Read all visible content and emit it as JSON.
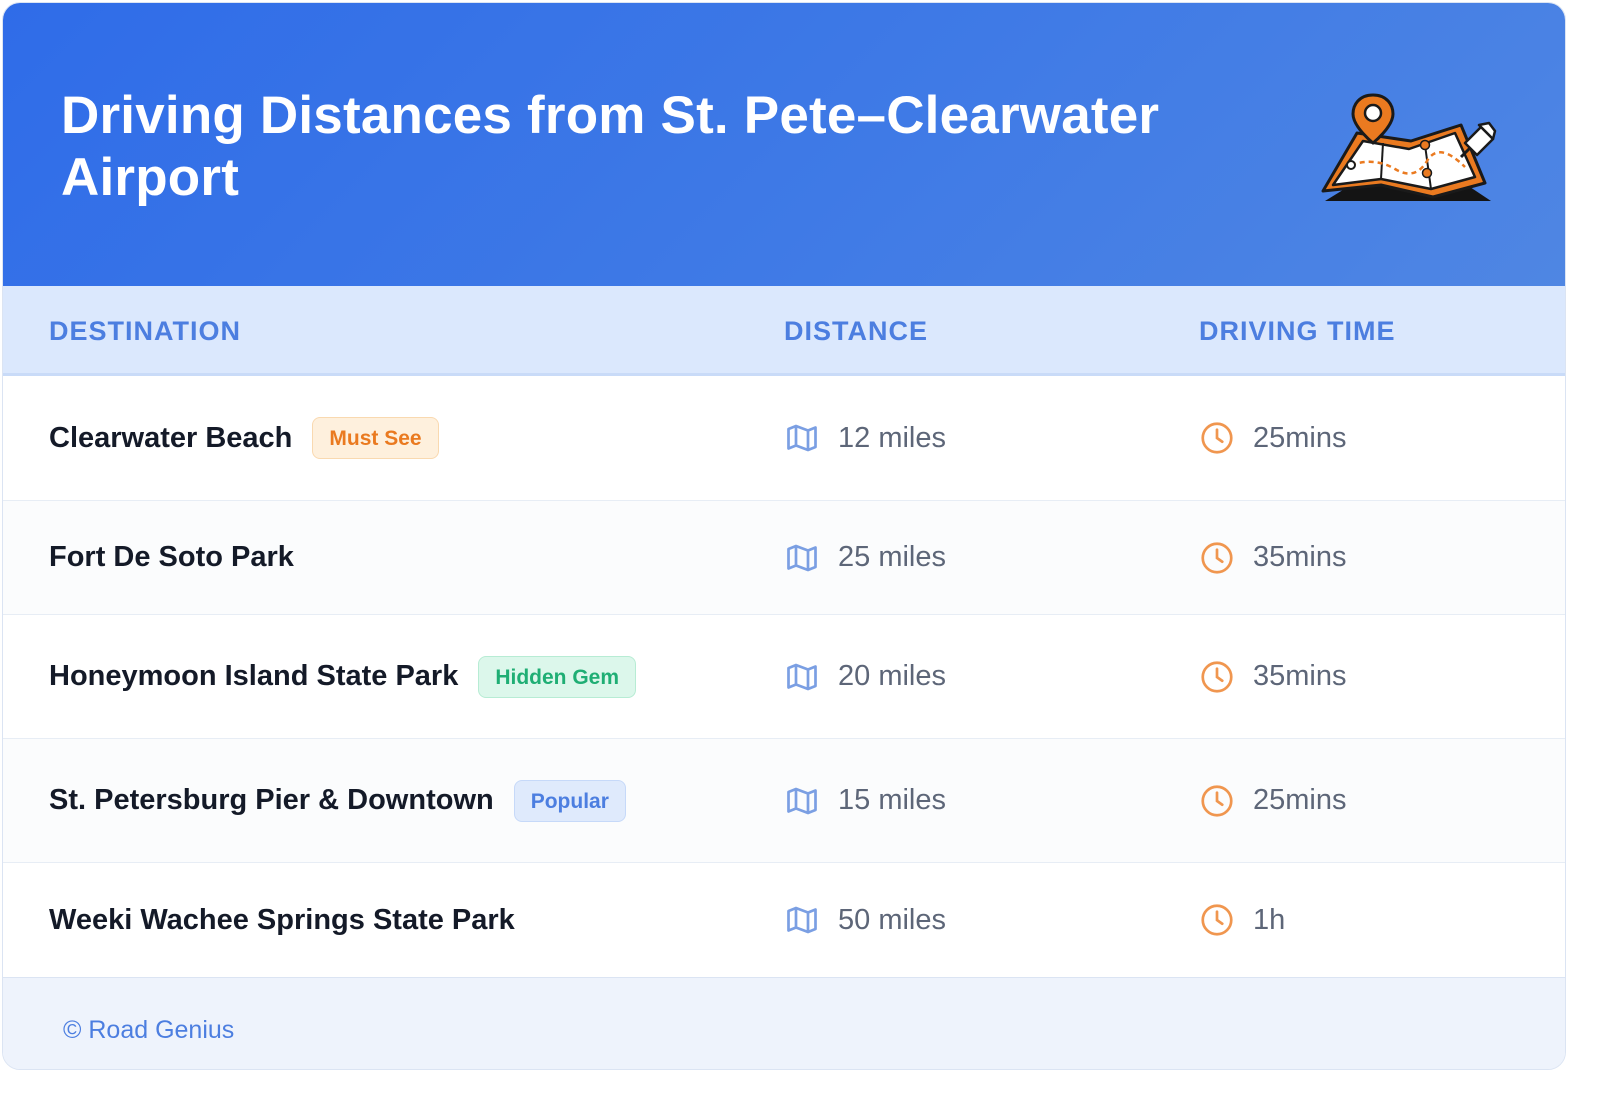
{
  "header": {
    "title": "Driving Distances from St. Pete–Clearwater Airport",
    "illustration_icon": "map-with-pins-icon"
  },
  "table": {
    "columns": [
      "DESTINATION",
      "DISTANCE",
      "DRIVING TIME"
    ],
    "rows": [
      {
        "destination": "Clearwater Beach",
        "badge": "Must See",
        "badge_color": "orange",
        "distance": "12 miles",
        "time": "25mins"
      },
      {
        "destination": "Fort De Soto Park",
        "badge": "",
        "badge_color": "",
        "distance": "25 miles",
        "time": "35mins"
      },
      {
        "destination": "Honeymoon Island State Park",
        "badge": "Hidden Gem",
        "badge_color": "green",
        "distance": "20 miles",
        "time": "35mins"
      },
      {
        "destination": "St. Petersburg Pier & Downtown",
        "badge": "Popular",
        "badge_color": "blue",
        "distance": "15 miles",
        "time": "25mins"
      },
      {
        "destination": "Weeki Wachee Springs State Park",
        "badge": "",
        "badge_color": "",
        "distance": "50 miles",
        "time": "1h"
      }
    ]
  },
  "icons": {
    "distance": "map-icon",
    "time": "clock-icon"
  },
  "colors": {
    "header_start": "#2f6ce8",
    "header_end": "#4f86e3",
    "accent_blue": "#4c7ee0",
    "accent_orange": "#ea7a20",
    "accent_green": "#1fae74"
  },
  "footer": {
    "text": "© Road Genius"
  }
}
